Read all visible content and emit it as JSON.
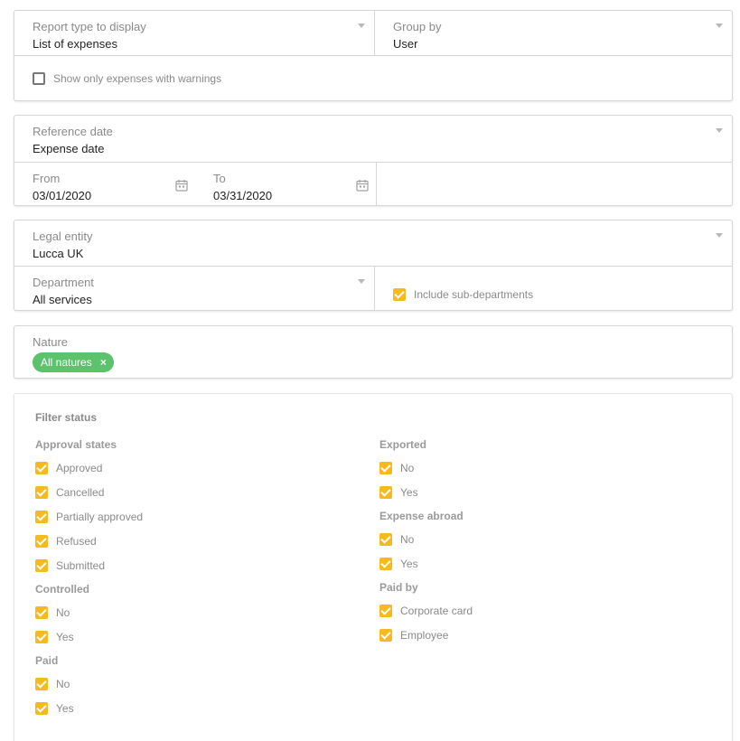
{
  "report": {
    "type_label": "Report type to display",
    "type_value": "List of expenses",
    "group_label": "Group by",
    "group_value": "User",
    "warnings_checkbox": "Show only expenses with warnings"
  },
  "dates": {
    "reference_label": "Reference date",
    "reference_value": "Expense date",
    "from_label": "From",
    "from_value": "03/01/2020",
    "to_label": "To",
    "to_value": "03/31/2020"
  },
  "entity": {
    "legal_label": "Legal entity",
    "legal_value": "Lucca UK",
    "department_label": "Department",
    "department_value": "All services",
    "subdepartments_checkbox": "Include sub-departments"
  },
  "nature": {
    "label": "Nature",
    "chip": "All natures",
    "chip_remove": "×"
  },
  "filter": {
    "title": "Filter status",
    "approval": {
      "title": "Approval states",
      "options": [
        "Approved",
        "Cancelled",
        "Partially approved",
        "Refused",
        "Submitted"
      ]
    },
    "controlled": {
      "title": "Controlled",
      "options": [
        "No",
        "Yes"
      ]
    },
    "paid": {
      "title": "Paid",
      "options": [
        "No",
        "Yes"
      ]
    },
    "exported": {
      "title": "Exported",
      "options": [
        "No",
        "Yes"
      ]
    },
    "abroad": {
      "title": "Expense abroad",
      "options": [
        "No",
        "Yes"
      ]
    },
    "paid_by": {
      "title": "Paid by",
      "options": [
        "Corporate card",
        "Employee"
      ]
    }
  },
  "colors": {
    "accent_checkbox": "#f6b91e",
    "chip": "#5cc26b"
  }
}
